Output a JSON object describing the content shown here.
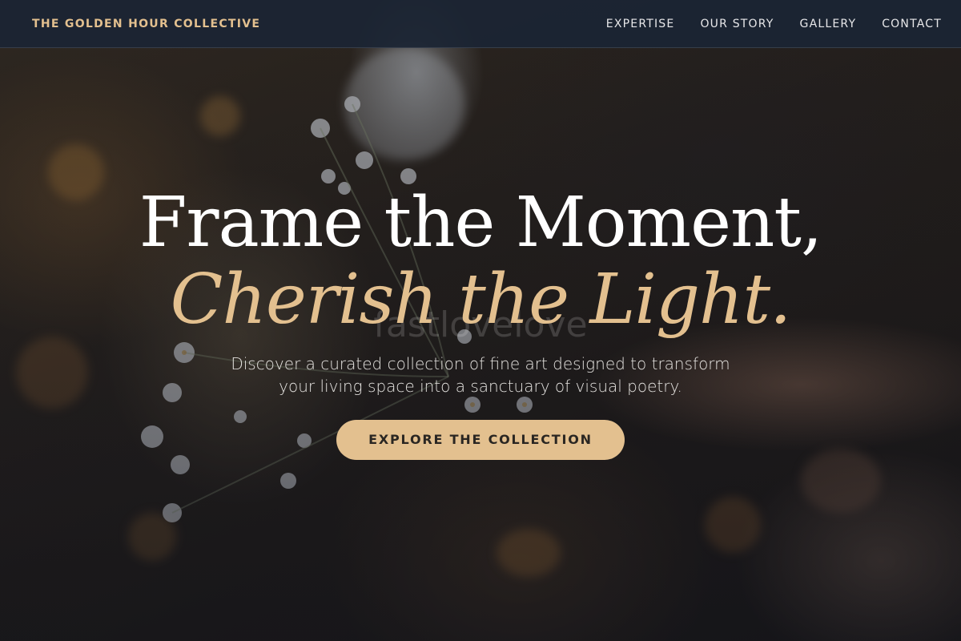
{
  "brand": {
    "name": "THE GOLDEN HOUR COLLECTIVE"
  },
  "nav": {
    "items": [
      {
        "label": "EXPERTISE"
      },
      {
        "label": "OUR STORY"
      },
      {
        "label": "GALLERY"
      },
      {
        "label": "CONTACT"
      }
    ]
  },
  "hero": {
    "title": "Frame the Moment,",
    "subtitle": "Cherish the Light.",
    "description": "Discover a curated collection of fine art designed to transform your living space into a sanctuary of visual poetry.",
    "cta_label": "EXPLORE THE COLLECTION",
    "watermark": "fastlovelove"
  },
  "colors": {
    "accent": "#e3c08f",
    "nav_bg": "#1b2534",
    "title": "#ffffff"
  }
}
